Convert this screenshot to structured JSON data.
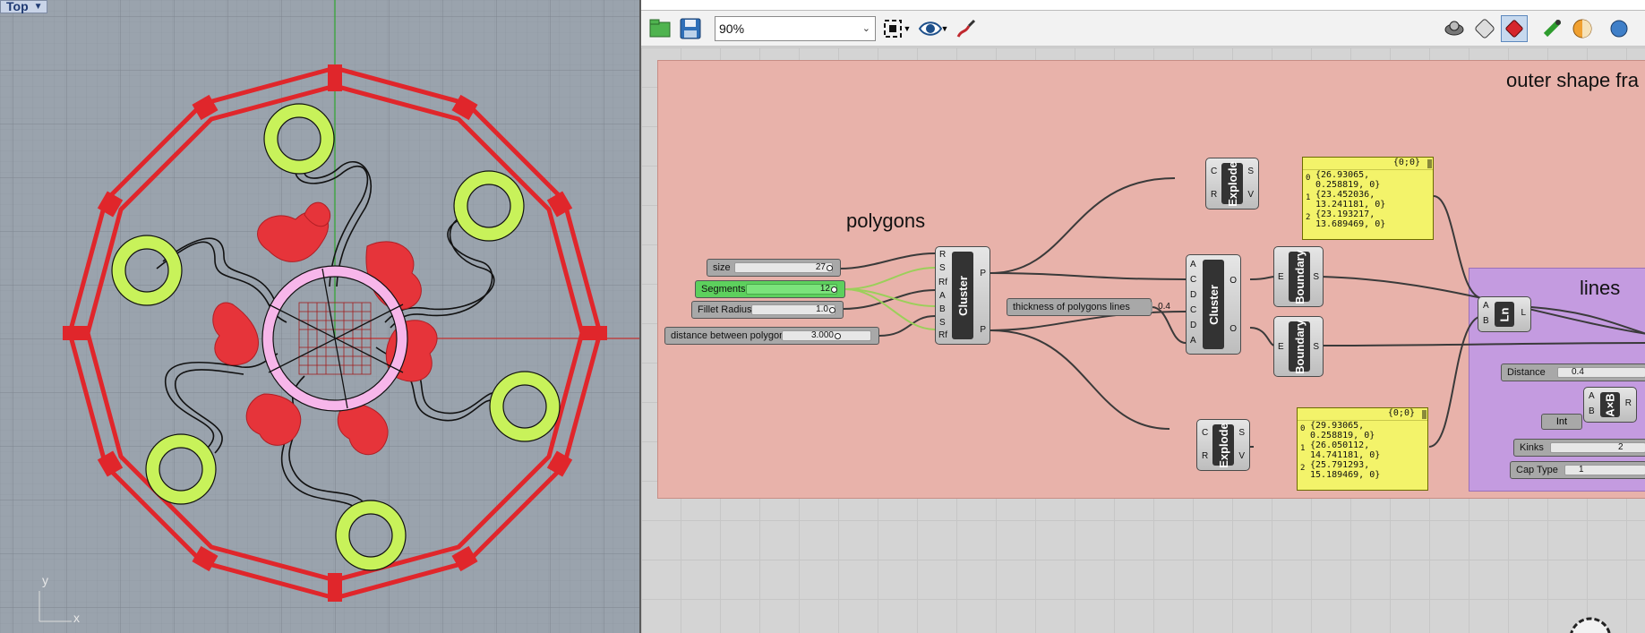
{
  "viewport": {
    "label": "Top",
    "axis_x": "x",
    "axis_y": "y"
  },
  "toolbar": {
    "zoom_value": "90%"
  },
  "groups": {
    "polygons_title": "polygons",
    "outer_title": "outer shape fra",
    "lines_title": "lines"
  },
  "sliders": [
    {
      "label": "size",
      "value": "27"
    },
    {
      "label": "Segments",
      "value": "12"
    },
    {
      "label": "Fillet Radius",
      "value": "1.0"
    },
    {
      "label": "distance between polygons",
      "value": "3.000"
    },
    {
      "label": "thickness of polygons lines",
      "value": "0.4"
    },
    {
      "label": "Distance",
      "value": "0.4"
    },
    {
      "label": "Kinks",
      "value": "2"
    },
    {
      "label": "Cap Type",
      "value": "1"
    }
  ],
  "components": {
    "cluster1": {
      "name": "Cluster",
      "inputs": [
        "R",
        "S",
        "Rf",
        "A",
        "B",
        "S",
        "Rf"
      ],
      "outputs": [
        "P",
        "P"
      ]
    },
    "cluster2": {
      "name": "Cluster",
      "inputs": [
        "A",
        "C",
        "D",
        "C",
        "D",
        "A"
      ],
      "outputs": [
        "O",
        "O"
      ]
    },
    "explode1": {
      "name": "Explode",
      "inputs": [
        "C",
        "R"
      ],
      "outputs": [
        "S",
        "V"
      ]
    },
    "explode2": {
      "name": "Explode",
      "inputs": [
        "C",
        "R"
      ],
      "outputs": [
        "S",
        "V"
      ]
    },
    "boundary1": {
      "name": "Boundary",
      "inputs": [
        "E"
      ],
      "outputs": [
        "S"
      ]
    },
    "boundary2": {
      "name": "Boundary",
      "inputs": [
        "E"
      ],
      "outputs": [
        "S"
      ]
    },
    "line": {
      "name": "Ln",
      "inputs": [
        "A",
        "B"
      ],
      "outputs": [
        "L"
      ]
    },
    "cross": {
      "name": "A×B",
      "inputs": [
        "A",
        "B"
      ],
      "outputs": [
        "R"
      ]
    },
    "int_param": {
      "name": "Int"
    }
  },
  "panels": [
    {
      "header": "{0;0}",
      "rows": [
        {
          "idx": "0",
          "text": "{26.93065,\n0.258819, 0}"
        },
        {
          "idx": "1",
          "text": "{23.452036,\n13.241181, 0}"
        },
        {
          "idx": "2",
          "text": "{23.193217,\n13.689469, 0}"
        }
      ]
    },
    {
      "header": "{0;0}",
      "rows": [
        {
          "idx": "0",
          "text": "{29.93065,\n0.258819, 0}"
        },
        {
          "idx": "1",
          "text": "{26.050112,\n14.741181, 0}"
        },
        {
          "idx": "2",
          "text": "{25.791293,\n15.189469, 0}"
        }
      ]
    }
  ],
  "colors": {
    "viewport_bg": "#9aa3ad",
    "polygons_group": "#e8b2aa",
    "lines_group": "#c49be0",
    "frame_red": "#e0262b",
    "ring_green": "#c8f25a",
    "pink_ring": "#f7b6ea"
  }
}
